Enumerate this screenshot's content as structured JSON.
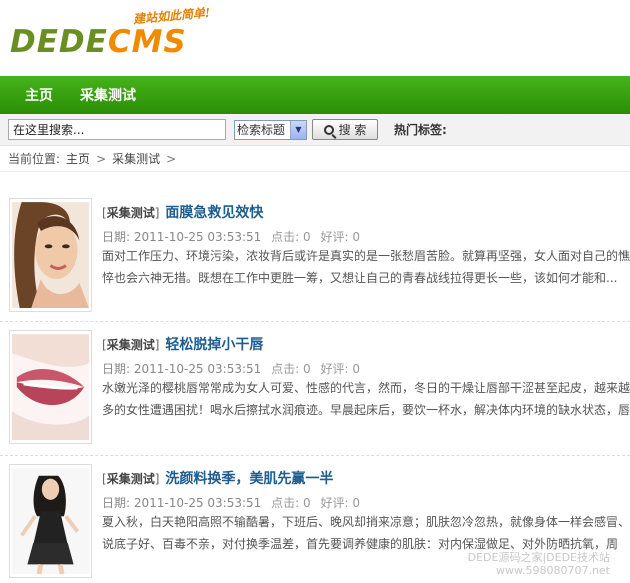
{
  "logo": {
    "part1": "DEDE",
    "part2": "CMS",
    "slogan": "建站如此简单!"
  },
  "nav": {
    "items": [
      "主页",
      "采集测试"
    ]
  },
  "search": {
    "placeholder": "在这里搜索...",
    "select_value": "检索标题",
    "button_label": "搜 索",
    "hot_tags_label": "热门标签:"
  },
  "breadcrumb": {
    "prefix": "当前位置:",
    "items": [
      "主页",
      "采集测试"
    ],
    "sep": ">"
  },
  "articles": [
    {
      "category": "采集测试",
      "title": "面膜急救见效快",
      "date": "日期: 2011-10-25 03:53:51",
      "clicks": "点击: 0",
      "comments": "好评: 0",
      "desc": "面对工作压力、环境污染，浓妆背后或许是真实的是一张愁眉苦脸。就算再坚强，女人面对自己的憔悴也会六神无措。既想在工作中更胜一筹，又想让自己的青春战线拉得更长一些，该如何才能和..."
    },
    {
      "category": "采集测试",
      "title": "轻松脱掉小干唇",
      "date": "日期: 2011-10-25 03:53:51",
      "clicks": "点击: 0",
      "comments": "好评: 0",
      "desc": "水嫩光泽的樱桃唇常常成为女人可爱、性感的代言，然而，冬日的干燥让唇部干涩甚至起皮，越来越多的女性遭遇困扰！喝水后擦拭水润痕迹。早晨起床后，要饮一杯水，解决体内环境的缺水状态，唇部..."
    },
    {
      "category": "采集测试",
      "title": "洗颜料换季，美肌先赢一半",
      "date": "日期: 2011-10-25 03:53:51",
      "clicks": "点击: 0",
      "comments": "好评: 0",
      "desc": "夏入秋，白天艳阳高照不输酷暑，下班后、晚风却捎来凉意；肌肤忽冷忽热，就像身体一样会感冒、说底子好、百毒不亲，对付换季温差，首先要调养健康的肌肤：对内保湿做足、对外防晒抗氧，周间..."
    }
  ],
  "watermark": {
    "line1": "DEDE源码之家|DEDE技术站",
    "line2": "www.598080707.net"
  },
  "colors": {
    "nav_green": "#2b8d06",
    "title_blue": "#1f5d8e",
    "logo_green": "#6a8e1f",
    "logo_orange": "#f08a00"
  }
}
